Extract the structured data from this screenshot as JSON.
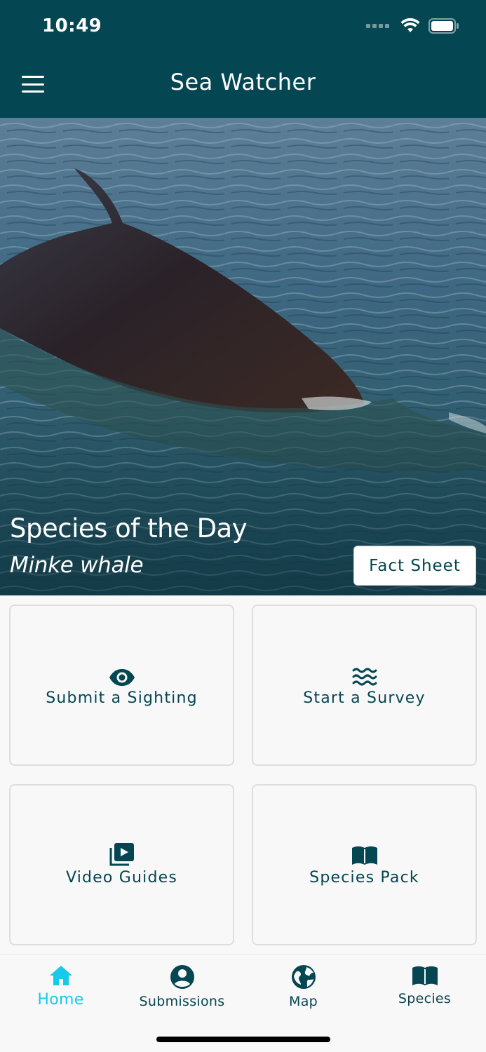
{
  "status": {
    "time": "10:49"
  },
  "header": {
    "title": "Sea Watcher",
    "menu_icon": "hamburger-menu-icon"
  },
  "hero": {
    "heading": "Species of the Day",
    "species": "Minke whale",
    "button_label": "Fact Sheet"
  },
  "tiles": [
    {
      "label": "Submit a Sighting",
      "icon": "eye-icon"
    },
    {
      "label": "Start a Survey",
      "icon": "waves-icon"
    },
    {
      "label": "Video Guides",
      "icon": "video-library-icon"
    },
    {
      "label": "Species Pack",
      "icon": "book-icon"
    }
  ],
  "nav": [
    {
      "label": "Home",
      "icon": "home-icon",
      "active": true
    },
    {
      "label": "Submissions",
      "icon": "account-circle-icon",
      "active": false
    },
    {
      "label": "Map",
      "icon": "globe-icon",
      "active": false
    },
    {
      "label": "Species",
      "icon": "book-icon",
      "active": false
    }
  ],
  "colors": {
    "primary": "#044652",
    "accent": "#19c9ec",
    "background": "#f8f8f8"
  }
}
